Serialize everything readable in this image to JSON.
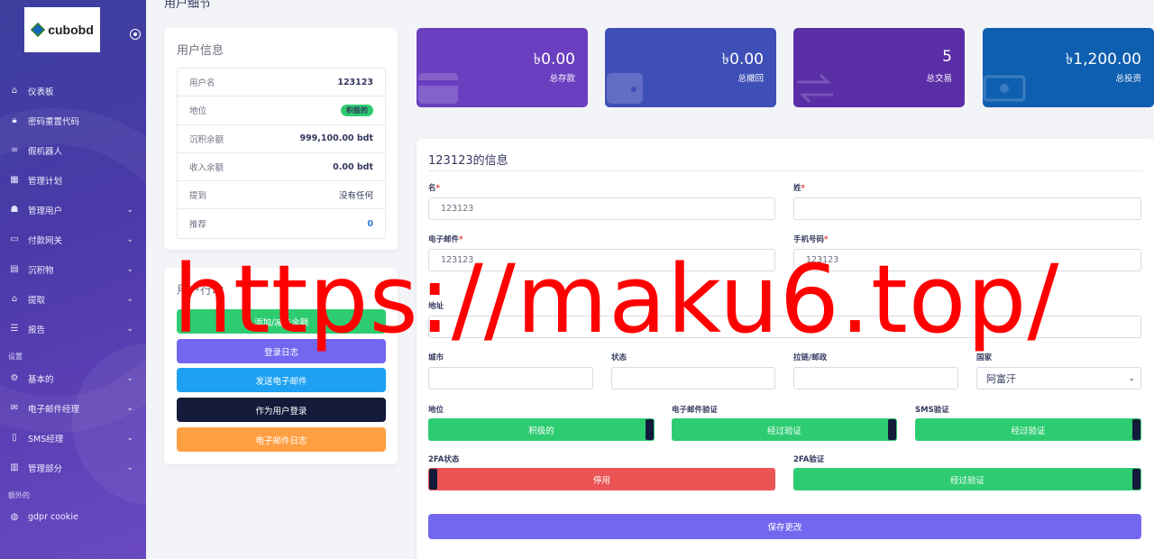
{
  "page": {
    "title": "用户细节"
  },
  "sidebar": {
    "logo_text": "cubobd",
    "items": [
      {
        "label": "仪表板",
        "icon": "home-icon",
        "chev": false
      },
      {
        "label": "密码重置代码",
        "icon": "lock-icon",
        "chev": false
      },
      {
        "label": "假机器人",
        "icon": "link-icon",
        "chev": false
      },
      {
        "label": "管理计划",
        "icon": "grid-icon",
        "chev": false
      },
      {
        "label": "管理用户",
        "icon": "users-icon",
        "chev": true
      },
      {
        "label": "付款网关",
        "icon": "card-icon",
        "chev": true
      },
      {
        "label": "沉积物",
        "icon": "wallet-icon",
        "chev": true
      },
      {
        "label": "提取",
        "icon": "bank-icon",
        "chev": true
      },
      {
        "label": "报告",
        "icon": "list-icon",
        "chev": true
      }
    ],
    "section_settings": "设置",
    "settings_items": [
      {
        "label": "基本的",
        "icon": "gear-icon",
        "chev": true
      },
      {
        "label": "电子邮件经理",
        "icon": "mail-icon",
        "chev": true
      },
      {
        "label": "SMS经理",
        "icon": "phone-icon",
        "chev": true
      },
      {
        "label": "管理部分",
        "icon": "doc-icon",
        "chev": true
      }
    ],
    "section_extra": "额外的",
    "extra_items": [
      {
        "label": "gdpr cookie",
        "icon": "cookie-icon",
        "chev": false
      }
    ]
  },
  "user_info": {
    "title": "用户信息",
    "rows": [
      {
        "key": "用户名",
        "value": "123123"
      },
      {
        "key": "地位",
        "value": "积极的"
      },
      {
        "key": "沉积余额",
        "value": "999,100.00 bdt"
      },
      {
        "key": "收入余额",
        "value": "0.00 bdt"
      },
      {
        "key": "提到",
        "value": "没有任何"
      },
      {
        "key": "推荐",
        "value": "0"
      }
    ]
  },
  "actions": {
    "title": "用户行动",
    "buttons": [
      "添加/减去余额",
      "登录日志",
      "发送电子邮件",
      "作为用户登录",
      "电子邮件日志"
    ]
  },
  "stats": [
    {
      "value": "৳0.00",
      "label": "总存款",
      "color": "#6a3fc0",
      "icon": "credit-card-icon"
    },
    {
      "value": "৳0.00",
      "label": "总撤回",
      "color": "#3f4fb8",
      "icon": "wallet-icon"
    },
    {
      "value": "5",
      "label": "总交易",
      "color": "#5a2fa6",
      "icon": "exchange-icon"
    },
    {
      "value": "৳1,200.00",
      "label": "总投资",
      "color": "#0f5fb0",
      "icon": "money-icon"
    }
  ],
  "form": {
    "title": "123123的信息",
    "first_name_label": "名",
    "first_name_value": "123123",
    "last_name_label": "姓",
    "last_name_value": "",
    "email_label": "电子邮件",
    "email_value": "123123",
    "mobile_label": "手机号码",
    "mobile_value": "123123",
    "address_label": "地址",
    "city_label": "城市",
    "state_label": "状态",
    "zip_label": "拉链/邮政",
    "country_label": "国家",
    "country_value": "阿富汗",
    "status_label": "地位",
    "status_value": "积极的",
    "email_verify_label": "电子邮件验证",
    "email_verify_value": "经过验证",
    "sms_verify_label": "SMS验证",
    "sms_verify_value": "经过验证",
    "twofa_status_label": "2FA状态",
    "twofa_status_value": "停用",
    "twofa_verify_label": "2FA验证",
    "twofa_verify_value": "经过验证",
    "save_label": "保存更改",
    "required_mark": "*"
  },
  "watermark": "https://maku6.top/"
}
